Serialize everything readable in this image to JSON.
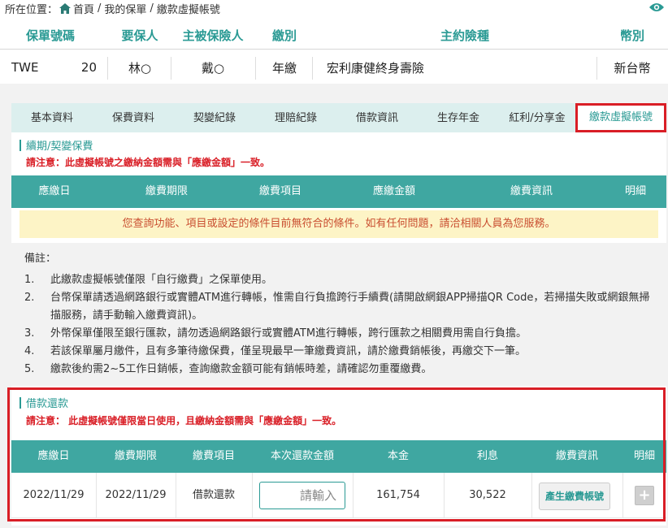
{
  "breadcrumb": {
    "prefix": "所在位置：",
    "home": "首頁",
    "my_policies": "我的保單",
    "current": "繳款虛擬帳號"
  },
  "icons": {
    "home": "home-icon",
    "visibility": "eye-icon"
  },
  "policy": {
    "headers": [
      "保單號碼",
      "要保人",
      "主被保險人",
      "繳別",
      "主約險種",
      "幣別"
    ],
    "row": {
      "number": "TWE           20",
      "applicant": "林○",
      "insured": "戴○",
      "payment_mode": "年繳",
      "product": "宏利康健終身壽險",
      "currency": "新台幣"
    }
  },
  "tabs": [
    {
      "label": "基本資料"
    },
    {
      "label": "保費資料"
    },
    {
      "label": "契變紀錄"
    },
    {
      "label": "理賠紀錄"
    },
    {
      "label": "借款資訊"
    },
    {
      "label": "生存年金"
    },
    {
      "label": "紅利/分享金"
    },
    {
      "label": "繳款虛擬帳號",
      "active": true
    }
  ],
  "renewal": {
    "title": "續期/契變保費",
    "notice": "請注意：此虛擬帳號之繳納金額需與「應繳金額」一致。",
    "columns": [
      "應繳日",
      "繳費期限",
      "繳費項目",
      "應繳金額",
      "繳費資訊",
      "明細"
    ],
    "empty_message": "您查詢功能、項目或設定的條件目前無符合的條件。如有任何問題，請洽相關人員為您服務。"
  },
  "remarks": {
    "title": "備註：",
    "items": [
      {
        "num": "1.",
        "text": "此繳款虛擬帳號僅限「自行繳費」之保單使用。"
      },
      {
        "num": "2.",
        "text": "台幣保單請透過網路銀行或實體ATM進行轉帳，惟需自行負擔跨行手續費(請開啟網銀APP掃描QR Code，若掃描失敗或網銀無掃描服務，請手動輸入繳費資訊)。"
      },
      {
        "num": "3.",
        "text": "外幣保單僅限至銀行匯款，請勿透過網路銀行或實體ATM進行轉帳，跨行匯款之相關費用需自行負擔。"
      },
      {
        "num": "4.",
        "text": "若該保單屬月繳件，且有多筆待繳保費，僅呈現最早一筆繳費資訊，請於繳費銷帳後，再繳交下一筆。"
      },
      {
        "num": "5.",
        "text": "繳款後約需2~5工作日銷帳，查詢繳款金額可能有銷帳時差，請確認勿重覆繳費。"
      }
    ]
  },
  "loan": {
    "title": "借款還款",
    "notice": "請注意： 此虛擬帳號僅限當日使用，且繳納金額需與「應繳金額」一致。",
    "columns": [
      "應繳日",
      "繳費期限",
      "繳費項目",
      "本次還款金額",
      "本金",
      "利息",
      "繳費資訊",
      "明細"
    ],
    "row": {
      "due_date": "2022/11/29",
      "deadline": "2022/11/29",
      "item": "借款還款",
      "amount_placeholder": "請輸入",
      "principal": "161,754",
      "interest": "30,522",
      "generate_button": "產生繳費帳號",
      "detail_button": "+"
    }
  },
  "colors": {
    "teal": "#3fa7a1",
    "teal_text": "#2a9a94",
    "highlight_red": "#d91e26",
    "warning_bg": "#fdf4c6"
  }
}
